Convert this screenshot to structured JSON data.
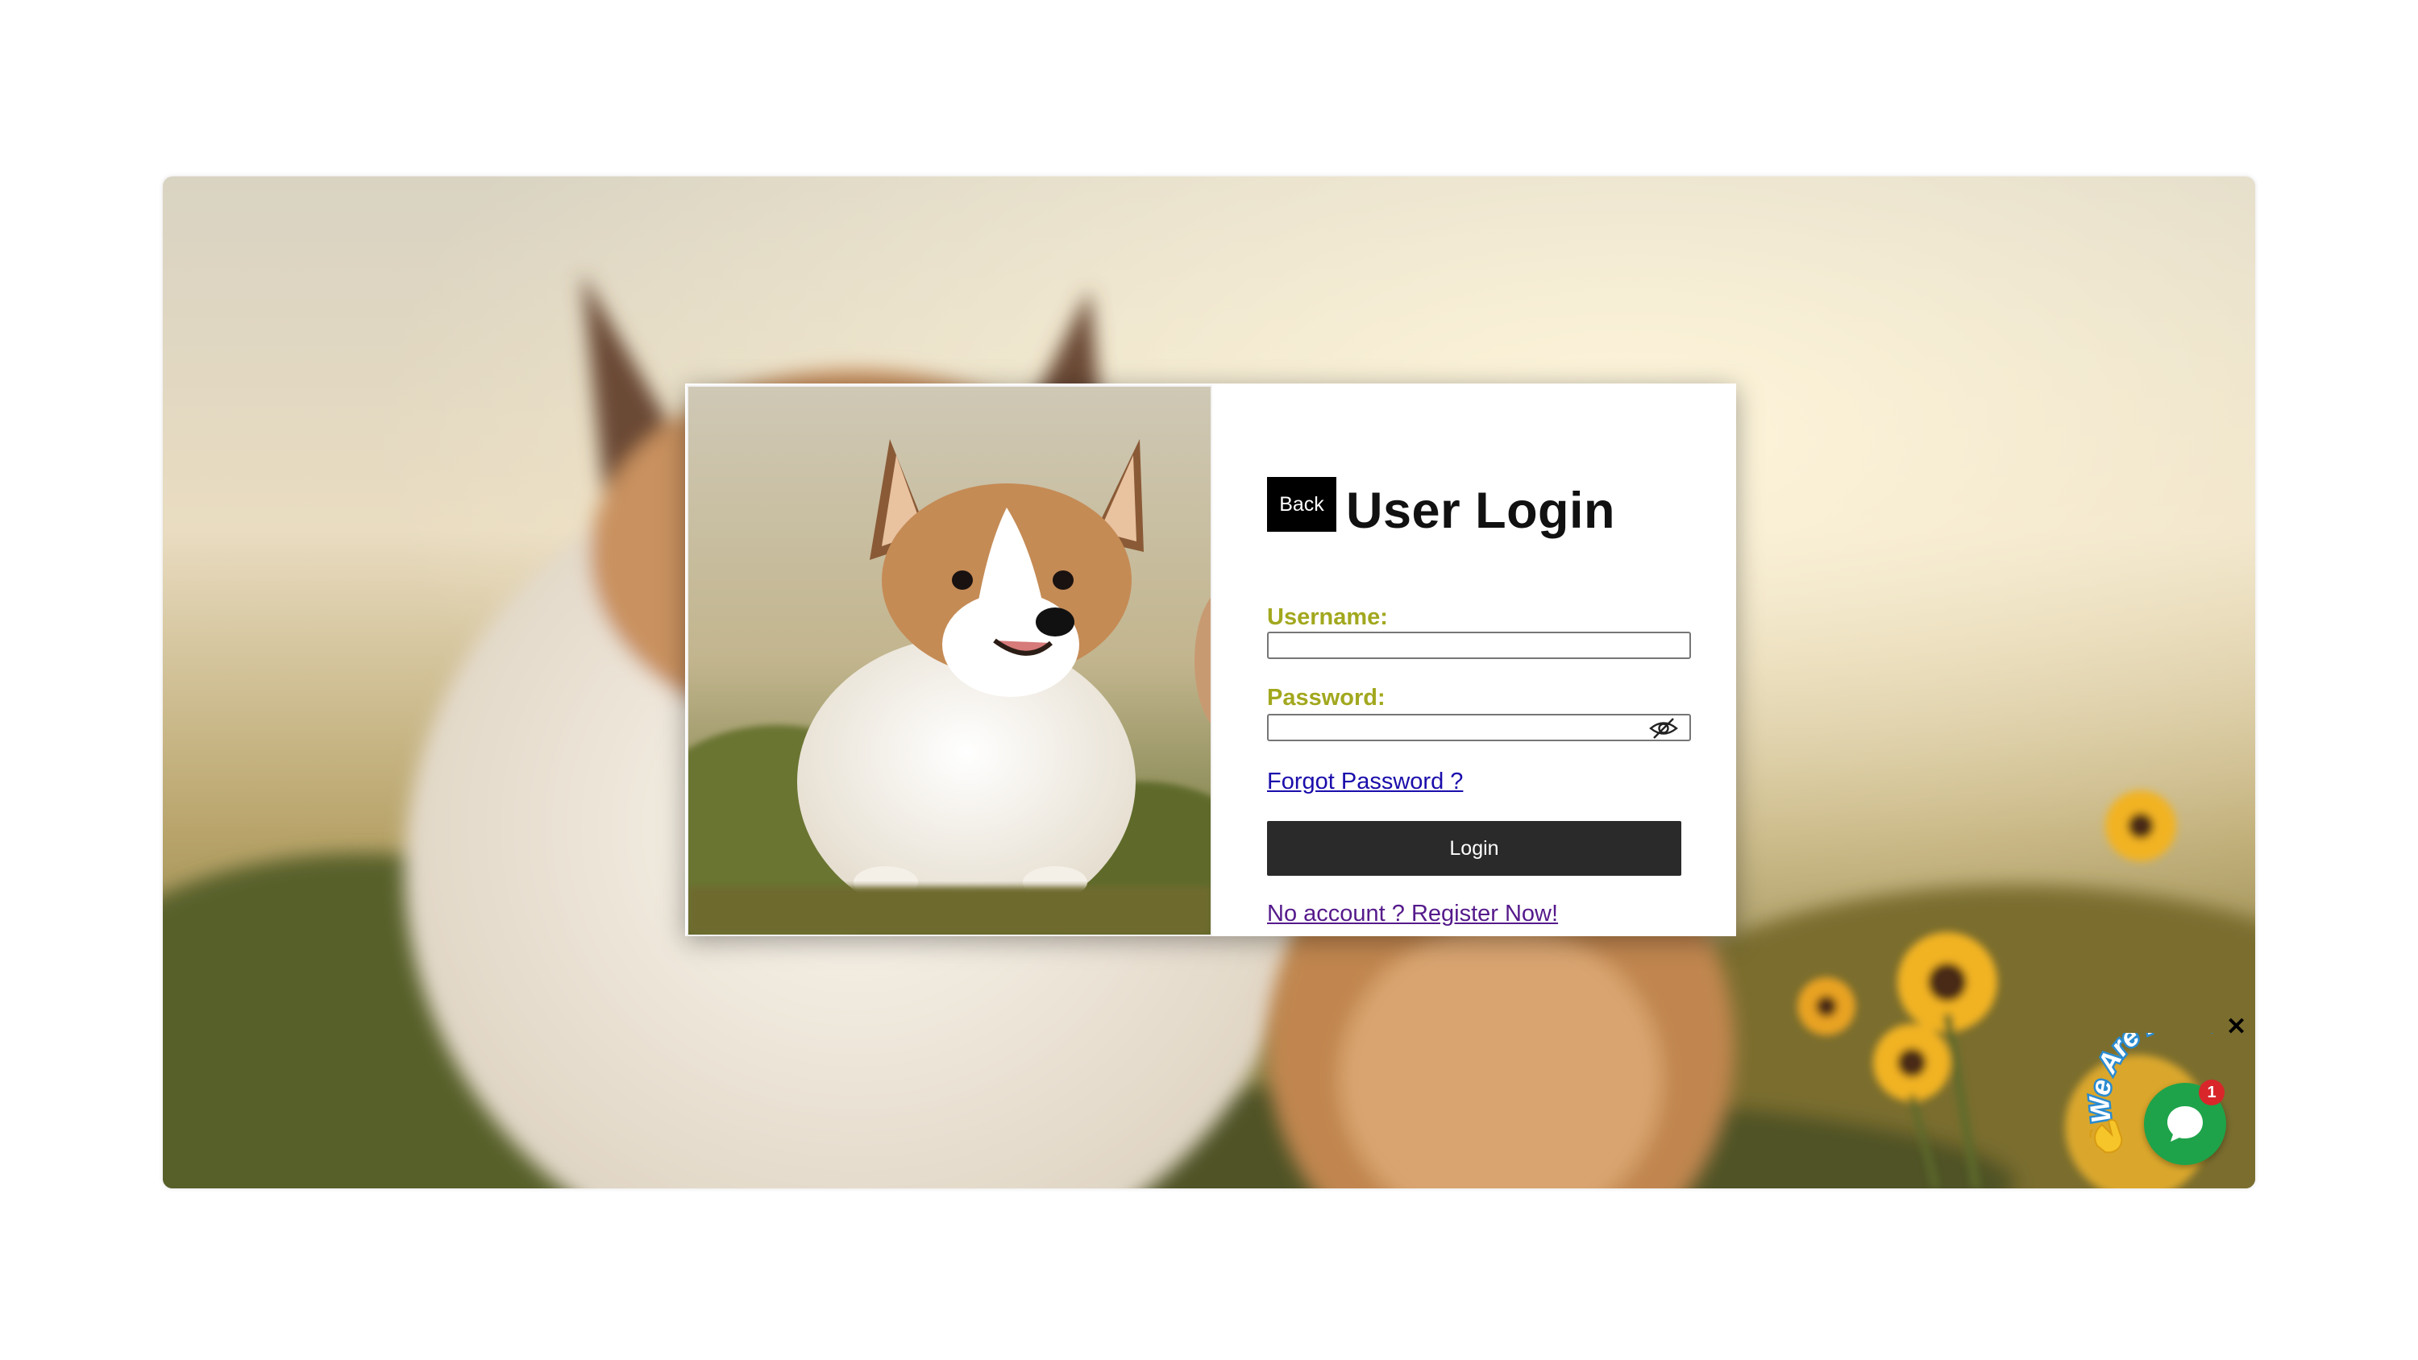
{
  "login_form": {
    "back_label": "Back",
    "title": "User Login",
    "username_label": "Username:",
    "username_value": "",
    "password_label": "Password:",
    "password_value": "",
    "password_toggle_icon": "eye-slash-icon",
    "forgot_password": "Forgot Password ?",
    "login_label": "Login",
    "register_link": "No account ? Register Now!"
  },
  "chat_widget": {
    "tagline": "We Are Here!",
    "unread_count": "1",
    "close_symbol": "✕",
    "bubble_icon": "chat-bubble-icon",
    "wave_icon": "waving-hand-icon",
    "accent_color": "#1ea34a",
    "badge_color": "#d8262b"
  },
  "colors": {
    "label_color": "#a2a81e",
    "button_dark": "#2a2a2a"
  }
}
